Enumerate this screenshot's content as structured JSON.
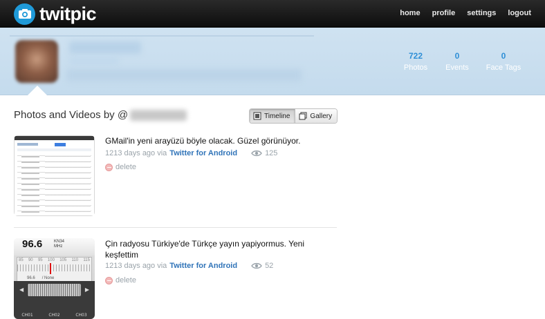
{
  "header": {
    "logo_text": "twitpic",
    "nav": [
      {
        "label": "home"
      },
      {
        "label": "profile"
      },
      {
        "label": "settings"
      },
      {
        "label": "logout"
      }
    ]
  },
  "profile": {
    "stats": [
      {
        "count": "722",
        "label": "Photos"
      },
      {
        "count": "0",
        "label": "Events"
      },
      {
        "count": "0",
        "label": "Face Tags"
      }
    ]
  },
  "content": {
    "heading": "Photos and Videos by @",
    "view_toggle": {
      "timeline_label": "Timeline",
      "gallery_label": "Gallery",
      "selected": "Timeline"
    }
  },
  "items": [
    {
      "caption": "GMail'in yeni arayüzü böyle olacak. Güzel görünüyor.",
      "age": "1213 days ago via",
      "client": "Twitter for Android",
      "views": "125",
      "delete_label": "delete"
    },
    {
      "caption": "Çin radyosu Türkiye'de Türkçe yayın yapiyormus. Yeni keşfettim",
      "age": "1213 days ago via",
      "client": "Twitter for Android",
      "views": "52",
      "delete_label": "delete",
      "thumb": {
        "frequency": "96.6",
        "band": "KN34",
        "unit": "MHz",
        "scale": [
          "85",
          "90",
          "95",
          "100",
          "105",
          "110",
          "115"
        ],
        "preset": "96.6",
        "preset_name": "/ None",
        "channels": [
          "CH01",
          "CH02",
          "CH03"
        ]
      }
    }
  ],
  "colors": {
    "accent": "#2f8fd6",
    "link": "#2f73b8",
    "banner": "#cfe2f1",
    "topbar": "#1a1a1a"
  }
}
